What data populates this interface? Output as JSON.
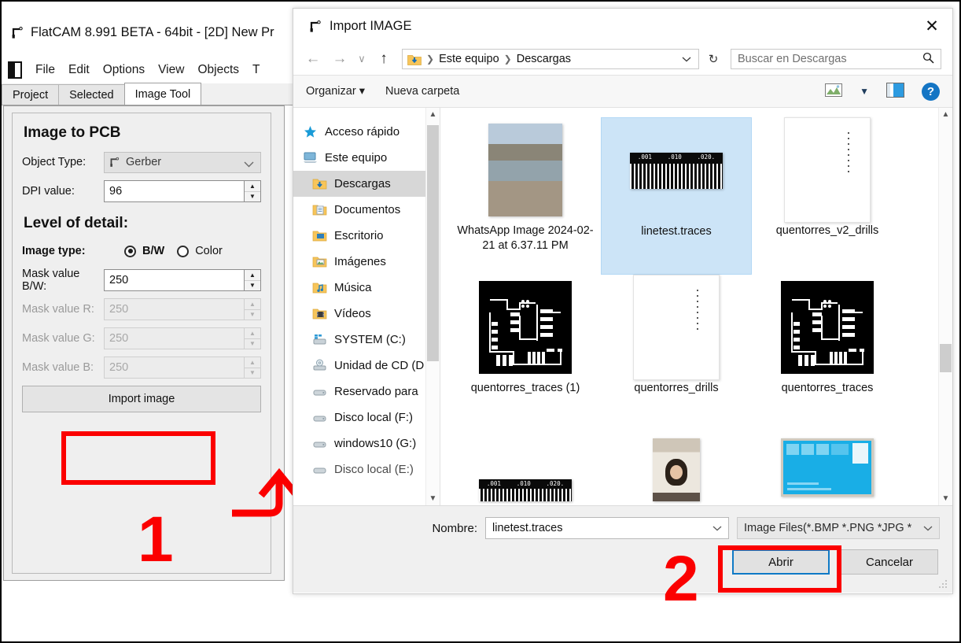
{
  "flatcam": {
    "title": "FlatCAM 8.991 BETA - 64bit - [2D]    New Pr",
    "menu": [
      "File",
      "Edit",
      "Options",
      "View",
      "Objects",
      "T"
    ],
    "tabs": [
      {
        "label": "Project",
        "active": false
      },
      {
        "label": "Selected",
        "active": false
      },
      {
        "label": "Image Tool",
        "active": true
      }
    ],
    "panel": {
      "heading": "Image to PCB",
      "object_type_label": "Object Type:",
      "object_type_value": "Gerber",
      "dpi_label": "DPI value:",
      "dpi_value": "96",
      "level_heading": "Level of detail:",
      "image_type_label": "Image type:",
      "radio_bw": "B/W",
      "radio_color": "Color",
      "mask_bw_label": "Mask value B/W:",
      "mask_bw_value": "250",
      "mask_r_label": "Mask value R:",
      "mask_r_value": "250",
      "mask_g_label": "Mask value G:",
      "mask_g_value": "250",
      "mask_b_label": "Mask value B:",
      "mask_b_value": "250",
      "import_button": "Import image"
    }
  },
  "annotations": {
    "step_one": "1",
    "step_two": "2",
    "highlight_color": "#fb0000"
  },
  "dialog": {
    "title": "Import IMAGE",
    "close_label": "✕",
    "nav": {
      "back": "←",
      "forward": "→",
      "recent": "∨",
      "up": "↑",
      "breadcrumb": [
        "Este equipo",
        "Descargas"
      ],
      "refresh": "↻",
      "search_placeholder": "Buscar en Descargas"
    },
    "toolbar": {
      "organize": "Organizar",
      "new_folder": "Nueva carpeta",
      "view_icon": "picture-view-icon",
      "layout_icon": "preview-pane-icon",
      "help_icon": "?"
    },
    "sidebar": [
      {
        "label": "Acceso rápido",
        "icon": "star-icon",
        "selected": false,
        "root": true
      },
      {
        "label": "Este equipo",
        "icon": "computer-icon",
        "selected": false,
        "root": true
      },
      {
        "label": "Descargas",
        "icon": "downloads-folder-icon",
        "selected": true,
        "root": false
      },
      {
        "label": "Documentos",
        "icon": "documents-folder-icon",
        "selected": false,
        "root": false
      },
      {
        "label": "Escritorio",
        "icon": "desktop-folder-icon",
        "selected": false,
        "root": false
      },
      {
        "label": "Imágenes",
        "icon": "pictures-folder-icon",
        "selected": false,
        "root": false
      },
      {
        "label": "Música",
        "icon": "music-folder-icon",
        "selected": false,
        "root": false
      },
      {
        "label": "Vídeos",
        "icon": "videos-folder-icon",
        "selected": false,
        "root": false
      },
      {
        "label": "SYSTEM (C:)",
        "icon": "hard-drive-icon",
        "selected": false,
        "root": false
      },
      {
        "label": "Unidad de CD (D",
        "icon": "cd-drive-icon",
        "selected": false,
        "root": false
      },
      {
        "label": "Reservado para ",
        "icon": "drive-icon",
        "selected": false,
        "root": false
      },
      {
        "label": "Disco local (F:)",
        "icon": "drive-icon",
        "selected": false,
        "root": false
      },
      {
        "label": "windows10 (G:)",
        "icon": "drive-icon",
        "selected": false,
        "root": false
      },
      {
        "label": "Disco local (E:)",
        "icon": "drive-icon",
        "selected": false,
        "root": false
      }
    ],
    "files": [
      {
        "label": "WhatsApp Image 2024-02-21 at 6.37.11 PM",
        "thumb": "photo-lake",
        "selected": false
      },
      {
        "label": "linetest.traces",
        "thumb": "ruler-barcode",
        "selected": true
      },
      {
        "label": "quentorres_v2_drills",
        "thumb": "white-sheet",
        "selected": false
      },
      {
        "label": "quentorres_traces (1)",
        "thumb": "pcb-traces",
        "selected": false
      },
      {
        "label": "quentorres_drills",
        "thumb": "white-sheet",
        "selected": false
      },
      {
        "label": "quentorres_traces",
        "thumb": "pcb-traces",
        "selected": false
      },
      {
        "label": "",
        "thumb": "ruler-barcode",
        "selected": false
      },
      {
        "label": "",
        "thumb": "photo-portrait",
        "selected": false
      },
      {
        "label": "",
        "thumb": "id-card",
        "selected": false
      }
    ],
    "bottom": {
      "nombre_label": "Nombre:",
      "nombre_value": "linetest.traces",
      "filter_value": "Image Files(*.BMP *.PNG *JPG *",
      "open_button": "Abrir",
      "cancel_button": "Cancelar"
    }
  }
}
